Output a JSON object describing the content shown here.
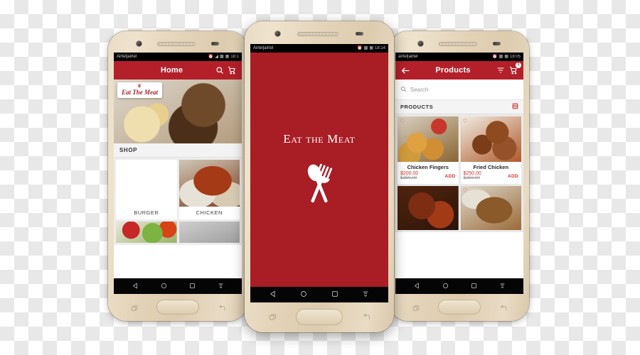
{
  "scene": {
    "description": "Three Android smartphones showing the Eat The Meat food ordering app",
    "brand_color": "#b3202a",
    "splash_color": "#a91d25",
    "phone_body_color": "#e6d8bf"
  },
  "phone_left": {
    "status_bar": {
      "carrier": "Airtel|airtel",
      "time": "18:1",
      "icons": [
        "alarm-icon",
        "wifi-icon",
        "signal-icon",
        "battery-icon"
      ]
    },
    "app_bar": {
      "title": "Home",
      "menu_icon": "hamburger-icon",
      "search_icon": "search-icon",
      "cart_icon": "cart-icon"
    },
    "hero": {
      "logo_crown": "♛",
      "logo_text": "Eat The Meat"
    },
    "section": {
      "title": "SHOP"
    },
    "categories": [
      {
        "name": "BURGER",
        "image": "f-burger"
      },
      {
        "name": "CHICKEN",
        "image": "f-chicken"
      },
      {
        "name": "",
        "image": "f-salad"
      },
      {
        "name": "",
        "image": "f-gray"
      }
    ],
    "nav": {
      "back": "back-icon",
      "home": "home-icon",
      "recents": "recents-icon",
      "keyboard": "keyboard-hide-icon"
    }
  },
  "phone_center": {
    "status_bar": {
      "carrier": "Airtel|airtel",
      "time": "18:14",
      "icons": [
        "alarm-icon",
        "signal-icon",
        "battery-icon"
      ]
    },
    "splash": {
      "brand": "Eat the Meat",
      "logo": "fork-and-spoon-icon"
    },
    "nav": {
      "back": "back-icon",
      "home": "home-icon",
      "recents": "recents-icon",
      "keyboard": "keyboard-hide-icon"
    }
  },
  "phone_right": {
    "status_bar": {
      "carrier": "airtel|airtel",
      "time": "18:05",
      "icons": [
        "alarm-icon",
        "signal-icon",
        "battery-icon"
      ]
    },
    "app_bar": {
      "title": "Products",
      "back_icon": "back-arrow-icon",
      "filter_icon": "filter-icon",
      "cart_icon": "cart-icon",
      "cart_badge": "1"
    },
    "search": {
      "placeholder": "Search",
      "icon": "search-icon"
    },
    "list_header": {
      "title": "PRODUCTS",
      "view_toggle_icon": "grid-view-icon"
    },
    "products": [
      {
        "name": "Chicken Fingers",
        "price": "$200.00",
        "old_price": "$250.00",
        "action": "ADD",
        "image": "f-fingers",
        "favorite_icon": "heart-icon"
      },
      {
        "name": "Fried Chicken",
        "price": "$250.00",
        "old_price": "$350.00",
        "action": "ADD",
        "image": "f-fried",
        "favorite_icon": "heart-icon"
      },
      {
        "name": "",
        "price": "",
        "old_price": "",
        "action": "",
        "image": "f-bbq",
        "favorite_icon": "heart-icon"
      },
      {
        "name": "",
        "price": "",
        "old_price": "",
        "action": "",
        "image": "f-roast",
        "favorite_icon": "heart-icon"
      }
    ],
    "nav": {
      "back": "back-icon",
      "home": "home-icon",
      "recents": "recents-icon",
      "keyboard": "keyboard-hide-icon"
    }
  }
}
